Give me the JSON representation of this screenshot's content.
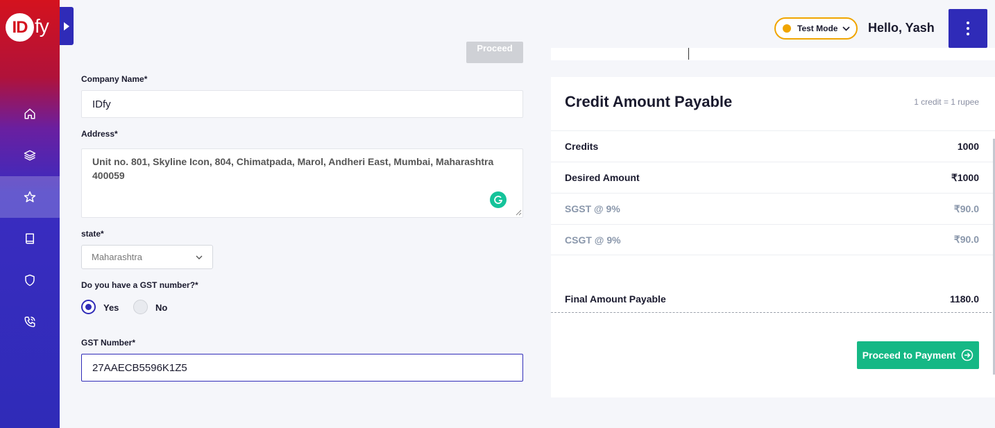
{
  "brand": {
    "logo_id": "ID",
    "logo_fy": "fy"
  },
  "colors": {
    "primary": "#2f2bb8",
    "accent": "#15b885",
    "warning": "#f0a500",
    "brand_red": "#d4121e"
  },
  "sidebar": {
    "items": [
      {
        "name": "home",
        "icon": "home-icon"
      },
      {
        "name": "layers",
        "icon": "layers-icon"
      },
      {
        "name": "favorites",
        "icon": "star-icon",
        "active": true
      },
      {
        "name": "docs",
        "icon": "book-icon"
      },
      {
        "name": "security",
        "icon": "shield-icon"
      },
      {
        "name": "support",
        "icon": "phone-icon"
      }
    ]
  },
  "header": {
    "mode_label": "Test Mode",
    "greeting": "Hello, Yash"
  },
  "form": {
    "proceed_label": "Proceed",
    "company_label": "Company Name*",
    "company_value": "IDfy",
    "address_label": "Address*",
    "address_value": "Unit no. 801, Skyline Icon, 804, Chimatpada, Marol, Andheri East, Mumbai, Maharashtra 400059",
    "state_label": "state*",
    "state_value": "Maharashtra",
    "gst_question": "Do you have a GST number?*",
    "yes_label": "Yes",
    "no_label": "No",
    "gst_label": "GST Number*",
    "gst_value": "27AAECB5596K1Z5"
  },
  "summary": {
    "title": "Credit Amount Payable",
    "note": "1 credit = 1 rupee",
    "rows": [
      {
        "label": "Credits",
        "value": "1000"
      },
      {
        "label": "Desired Amount",
        "value": "₹1000"
      },
      {
        "label": "SGST @ 9%",
        "value": "₹90.0"
      },
      {
        "label": "CSGT @ 9%",
        "value": "₹90.0"
      }
    ],
    "final_label": "Final Amount Payable",
    "final_value": "1180.0",
    "pay_label": "Proceed to Payment"
  }
}
